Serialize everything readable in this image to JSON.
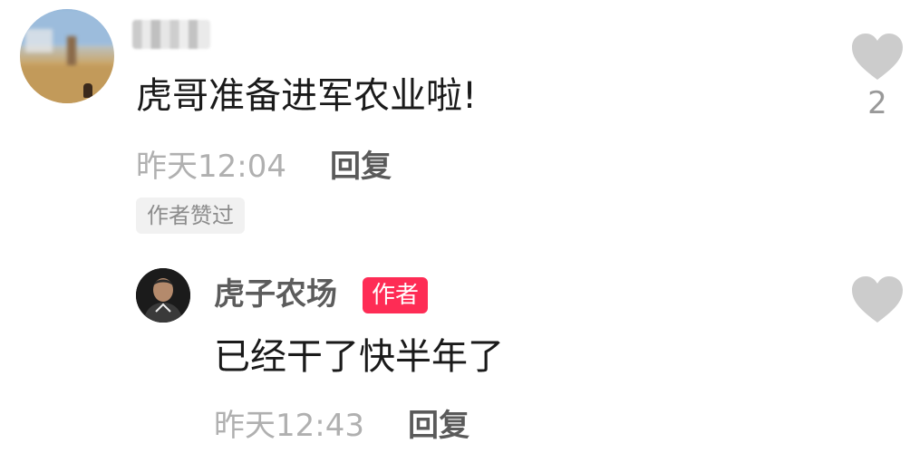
{
  "comment": {
    "username": "",
    "text": "虎哥准备进军农业啦!",
    "time": "昨天12:04",
    "reply_label": "回复",
    "liked_badge": "作者赞过",
    "like_count": "2"
  },
  "reply": {
    "username": "虎子农场",
    "author_badge": "作者",
    "text": "已经干了快半年了",
    "time": "昨天12:43",
    "reply_label": "回复"
  },
  "icons": {
    "like": "heart-icon",
    "like_color": "#cccccc"
  },
  "colors": {
    "author_badge": "#fe2c55",
    "time": "#b0b0b0",
    "reply": "#5a5a5a"
  }
}
